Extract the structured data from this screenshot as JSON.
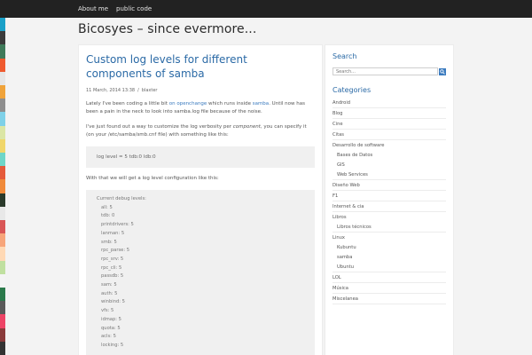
{
  "strip_colors": [
    "#1aa0c8",
    "#3b3b3b",
    "#3f7a5a",
    "#ef5a2f",
    "#e6e6e6",
    "#f0a33a",
    "#8e8e8e",
    "#7fd1e8",
    "#dbe6a5",
    "#f0d66a",
    "#6fd6c8",
    "#e55a3a",
    "#f08a3a",
    "#2a3a2a",
    "#e8e8e8",
    "#d95656",
    "#f7a57a",
    "#ffd9b5",
    "#c0e0a0",
    "#f4f4f4",
    "#2b7a4b",
    "#5a5a5a",
    "#ee4466",
    "#8a3a3a",
    "#333333"
  ],
  "nav": {
    "items": [
      "About me",
      "public code"
    ]
  },
  "site": {
    "title": "Bicosyes – since evermore..."
  },
  "post": {
    "title": "Custom log levels for different components of samba",
    "date": "11 March, 2014 13:38",
    "sep": "/",
    "author": "blaxter",
    "p1": {
      "pre": "Lately I've been coding a little bit ",
      "link1": "on openchange",
      "mid": " which runs inside ",
      "link2": "samba",
      "post": ". Until now has been a pain in the neck to look into samba.log file because of the noise."
    },
    "p2": {
      "pre": "I've just found out a way to customize the log verbosity per ",
      "em": "component",
      "post": ", you can specify it (on your /etc/samba/smb.cnf file) with something like this:"
    },
    "code1": "log level = 5 tdb:0 ldb:0",
    "p3": "With that we will get a log level configuration like this:",
    "code2_header": "Current debug levels:",
    "code2_lines": [
      "all: 5",
      "tdb: 0",
      "printdrivers: 5",
      "lanman: 5",
      "smb: 5",
      "rpc_parse: 5",
      "rpc_srv: 5",
      "rpc_cli: 5",
      "passdb: 5",
      "sam: 5",
      "auth: 5",
      "winbind: 5",
      "vfs: 5",
      "idmap: 5",
      "quota: 5",
      "acls: 5",
      "locking: 5"
    ]
  },
  "sidebar": {
    "search_title": "Search",
    "search_placeholder": "Search...",
    "categories_title": "Categories",
    "categories": [
      {
        "label": "Android",
        "level": 0
      },
      {
        "label": "Blog",
        "level": 0
      },
      {
        "label": "Cine",
        "level": 0
      },
      {
        "label": "Citas",
        "level": 0
      },
      {
        "label": "Desarrollo de software",
        "level": 0
      },
      {
        "label": "Bases de Datos",
        "level": 1
      },
      {
        "label": "GIS",
        "level": 1
      },
      {
        "label": "Web Services",
        "level": 1
      },
      {
        "label": "Diseño Web",
        "level": 0
      },
      {
        "label": "F1",
        "level": 0
      },
      {
        "label": "Internet & cia",
        "level": 0
      },
      {
        "label": "Libros",
        "level": 0
      },
      {
        "label": "Libros técnicos",
        "level": 1
      },
      {
        "label": "Linux",
        "level": 0
      },
      {
        "label": "Kubuntu",
        "level": 1
      },
      {
        "label": "samba",
        "level": 1
      },
      {
        "label": "Ubuntu",
        "level": 1
      },
      {
        "label": "LOL",
        "level": 0
      },
      {
        "label": "Música",
        "level": 0
      },
      {
        "label": "Miscelanea",
        "level": 0
      }
    ]
  }
}
